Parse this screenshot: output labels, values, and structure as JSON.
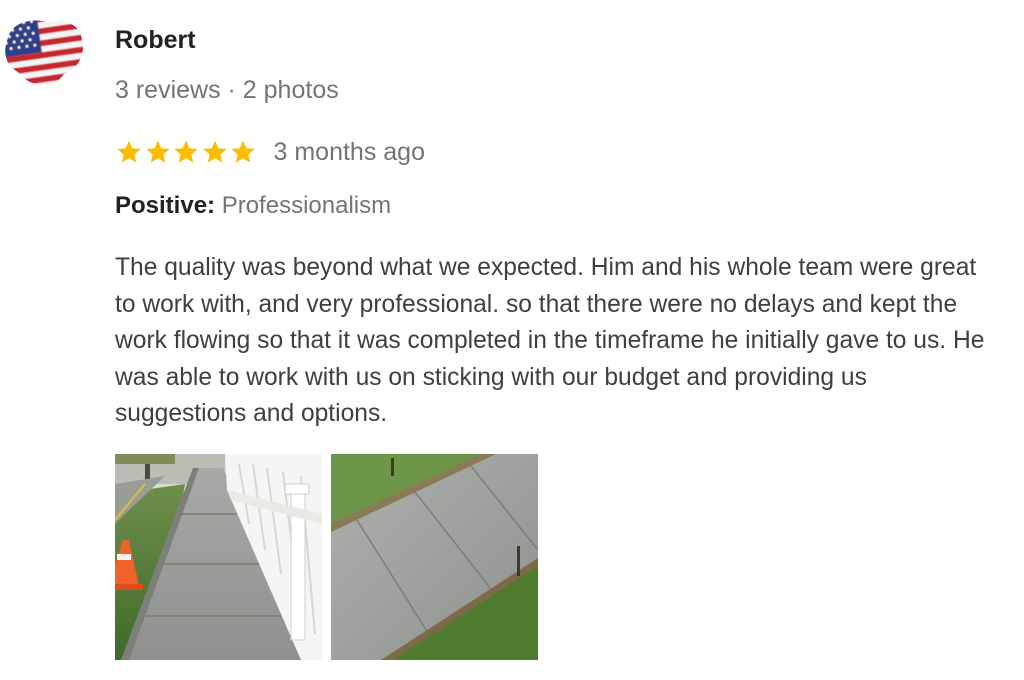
{
  "review": {
    "author": "Robert",
    "author_meta": "3 reviews · 2 photos",
    "rating": 5,
    "rating_max": 5,
    "date": "3 months ago",
    "attribute_label": "Positive:",
    "attribute_value": "Professionalism",
    "text": "The quality was beyond what we expected. Him and his whole team were great to work with, and very professional. so that there were no delays and kept the work flowing so that it was completed in the timeframe he initially gave to us. He was able to work with us on sticking with our budget and providing us suggestions and options."
  },
  "colors": {
    "star": "#fbbc04",
    "name": "#202124",
    "secondary": "#70757a",
    "body_text": "#3c4043"
  },
  "icons": {
    "avatar": "american-flag-avatar",
    "star": "star-icon"
  }
}
